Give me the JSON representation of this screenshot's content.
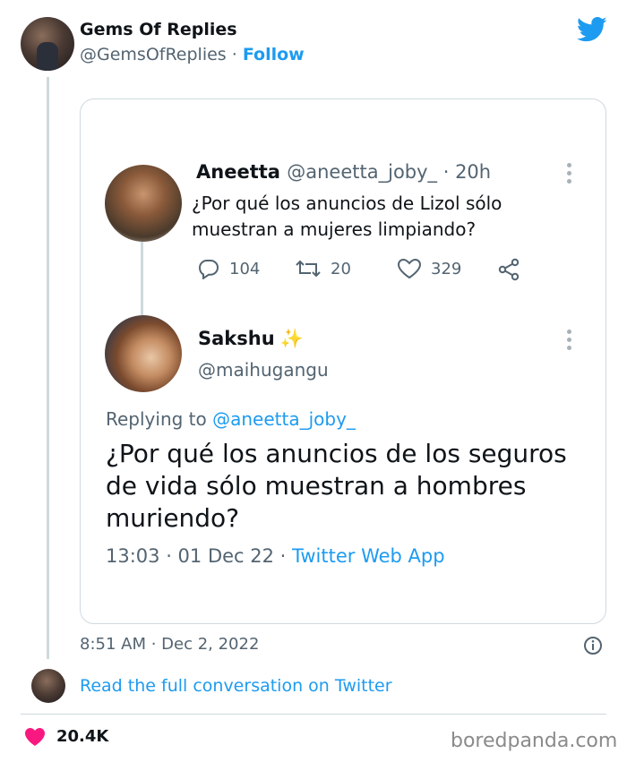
{
  "embed": {
    "author_name": "Gems Of Replies",
    "author_handle": "@GemsOfReplies",
    "separator": " · ",
    "follow_label": "Follow",
    "timestamp": "8:51 AM · Dec 2, 2022",
    "read_more": "Read the full conversation on Twitter",
    "like_count": "20.4K"
  },
  "quoted": {
    "original": {
      "name": "Aneetta",
      "handle_time": "@aneetta_joby_ · 20h",
      "text": "¿Por qué los anuncios de Lizol sólo muestran a mujeres limpiando?",
      "replies": "104",
      "retweets": "20",
      "likes": "329"
    },
    "reply": {
      "name": "Sakshu",
      "emoji": "✨",
      "handle": "@maihugangu",
      "replying_prefix": "Replying to ",
      "replying_to": "@aneetta_joby_",
      "text": "¿Por qué los anuncios de los seguros de vida sólo muestran a hombres muriendo?",
      "time": "13:03 · 01 Dec 22 · ",
      "app": "Twitter Web App"
    }
  },
  "watermark": "boredpanda.com",
  "colors": {
    "accent": "#1d9bf0",
    "heart": "#f91880",
    "text": "#0f1419",
    "muted": "#536471",
    "border": "#cfd9de"
  },
  "icons": [
    "twitter-bird-icon",
    "more-dots-icon",
    "reply-icon",
    "retweet-icon",
    "like-icon",
    "share-icon",
    "info-icon",
    "heart-icon"
  ]
}
